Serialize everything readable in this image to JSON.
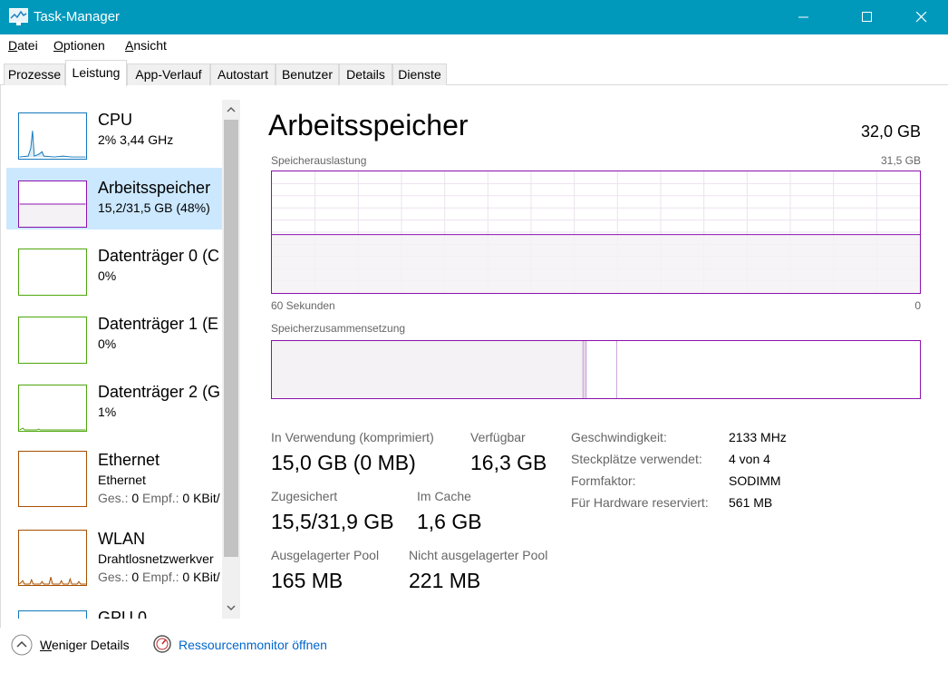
{
  "window": {
    "title": "Task-Manager",
    "titlebar_color": "#0099bc"
  },
  "menu": [
    {
      "label": "Datei",
      "accel": "D",
      "rest": "atei"
    },
    {
      "label": "Optionen",
      "accel": "O",
      "rest": "ptionen"
    },
    {
      "label": "Ansicht",
      "accel": "A",
      "rest": "nsicht"
    }
  ],
  "tabs": [
    {
      "label": "Prozesse",
      "active": false
    },
    {
      "label": "Leistung",
      "active": true
    },
    {
      "label": "App-Verlauf",
      "active": false
    },
    {
      "label": "Autostart",
      "active": false
    },
    {
      "label": "Benutzer",
      "active": false
    },
    {
      "label": "Details",
      "active": false
    },
    {
      "label": "Dienste",
      "active": false
    }
  ],
  "sidebar": {
    "items": [
      {
        "title": "CPU",
        "sub": "2%  3,44 GHz",
        "color": "#1177bb",
        "selected": false
      },
      {
        "title": "Arbeitsspeicher",
        "sub": "15,2/31,5 GB (48%)",
        "color": "#8b12ae",
        "selected": true
      },
      {
        "title": "Datenträger 0 (C",
        "sub": "0%",
        "color": "#4da60c",
        "selected": false
      },
      {
        "title": "Datenträger 1 (E",
        "sub": "0%",
        "color": "#4da60c",
        "selected": false
      },
      {
        "title": "Datenträger 2 (G",
        "sub": "1%",
        "color": "#4da60c",
        "selected": false
      },
      {
        "title": "Ethernet",
        "sub": "Ethernet",
        "sub2_ges_label": "Ges.:",
        "sub2_ges": "0",
        "sub2_empf_label": "Empf.:",
        "sub2_empf": "0 KBit/",
        "color": "#a74f01",
        "selected": false
      },
      {
        "title": "WLAN",
        "sub": "Drahtlosnetzwerkver",
        "sub2_ges_label": "Ges.:",
        "sub2_ges": "0",
        "sub2_empf_label": "Empf.:",
        "sub2_empf": "0 KBit/",
        "color": "#a74f01",
        "selected": false
      },
      {
        "title": "GPU 0",
        "sub": "",
        "color": "#1177bb",
        "selected": false
      }
    ]
  },
  "main": {
    "title": "Arbeitsspeicher",
    "total": "32,0 GB",
    "usage_label": "Speicherauslastung",
    "usage_max": "31,5 GB",
    "axis_left": "60 Sekunden",
    "axis_right": "0",
    "usage_fraction": 0.48,
    "composition_label": "Speicherzusammensetzung",
    "composition": {
      "in_use_fraction": 0.48,
      "modified_fraction": 0.005,
      "standby_fraction": 0.047
    },
    "stats": {
      "in_use_label": "In Verwendung (komprimiert)",
      "in_use_value": "15,0 GB (0 MB)",
      "available_label": "Verfügbar",
      "available_value": "16,3 GB",
      "committed_label": "Zugesichert",
      "committed_value": "15,5/31,9 GB",
      "cached_label": "Im Cache",
      "cached_value": "1,6 GB",
      "paged_label": "Ausgelagerter Pool",
      "paged_value": "165 MB",
      "nonpaged_label": "Nicht ausgelagerter Pool",
      "nonpaged_value": "221 MB"
    },
    "properties": [
      {
        "label": "Geschwindigkeit:",
        "value": "2133 MHz"
      },
      {
        "label": "Steckplätze verwendet:",
        "value": "4 von 4"
      },
      {
        "label": "Formfaktor:",
        "value": "SODIMM"
      },
      {
        "label": "Für Hardware reserviert:",
        "value": "561 MB"
      }
    ]
  },
  "footer": {
    "less_details_accel": "W",
    "less_details_rest": "eniger Details",
    "resource_monitor": "Ressourcenmonitor öffnen"
  },
  "colors": {
    "memory": "#8b12ae",
    "memory_fill": "#f4f2f4",
    "link": "#0066cc",
    "selection": "#cce8ff"
  }
}
